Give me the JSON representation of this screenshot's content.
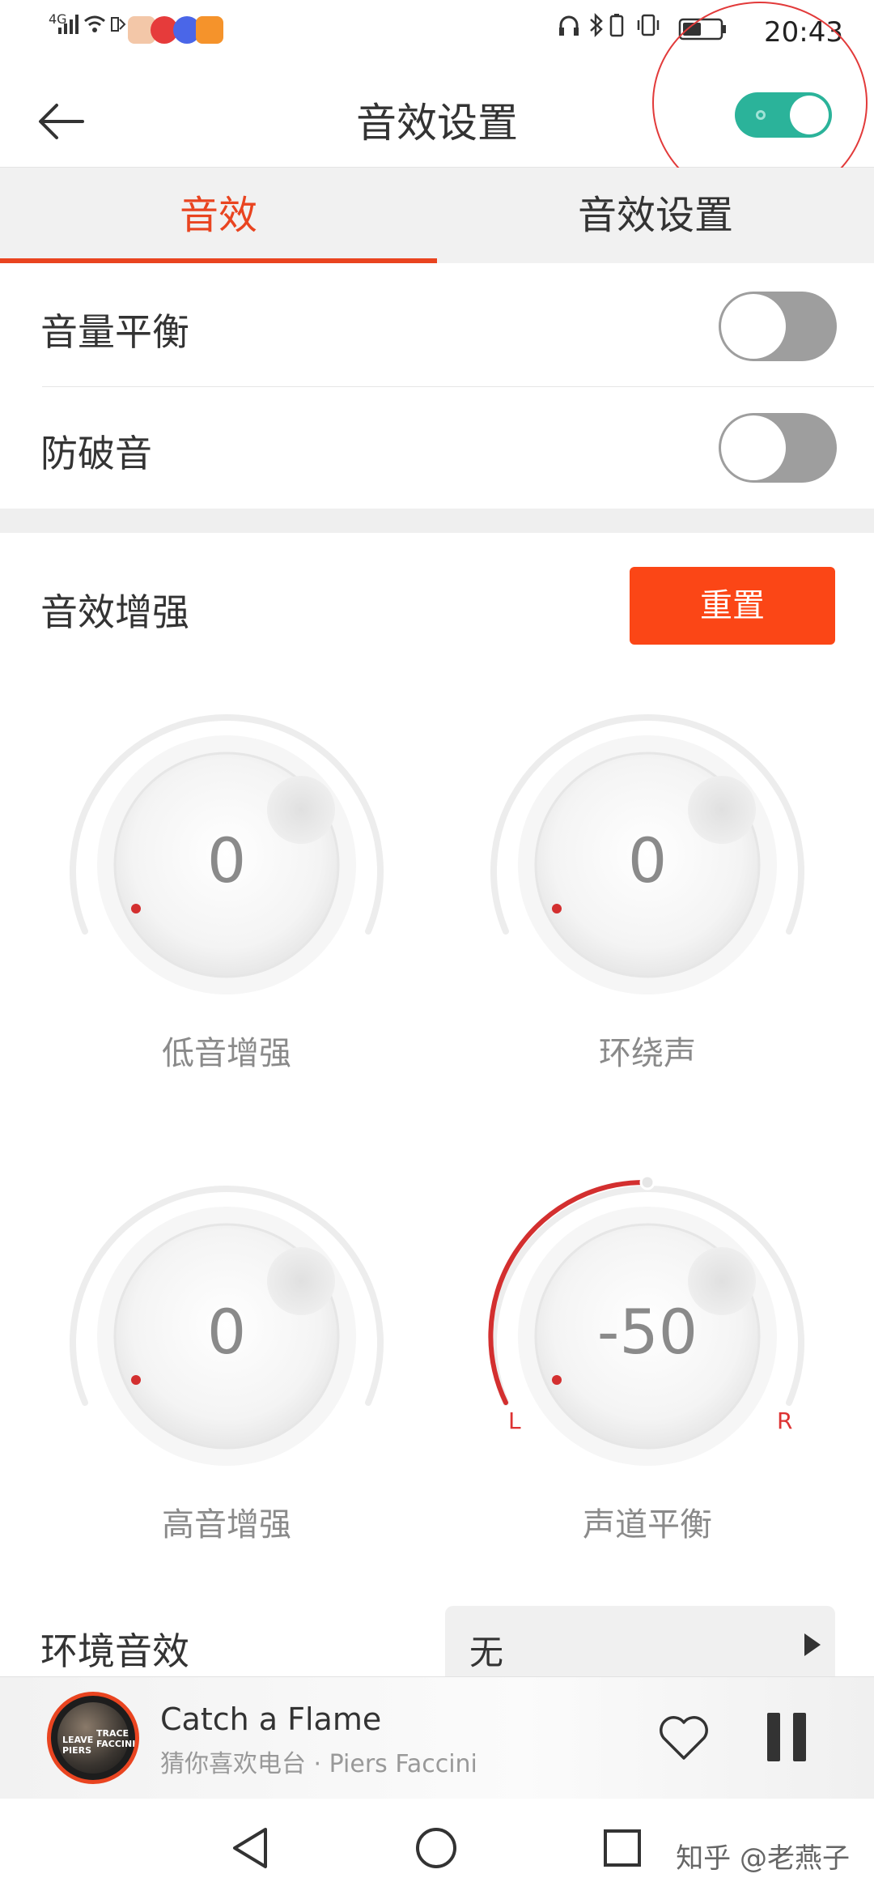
{
  "status_bar": {
    "network": "4G",
    "time": "20:43",
    "app_icons": [
      "news-app-icon",
      "weibo-icon",
      "music-icon",
      "video-icon"
    ]
  },
  "header": {
    "title": "音效设置",
    "master_toggle_on": true
  },
  "tabs": [
    {
      "label": "音效",
      "active": true
    },
    {
      "label": "音效设置",
      "active": false
    }
  ],
  "settings": {
    "volume_balance": {
      "label": "音量平衡",
      "on": false
    },
    "anti_clipping": {
      "label": "防破音",
      "on": false
    }
  },
  "enhancement": {
    "title": "音效增强",
    "reset_label": "重置",
    "knobs": {
      "bass": {
        "label": "低音增强",
        "value": "0"
      },
      "surround": {
        "label": "环绕声",
        "value": "0"
      },
      "treble": {
        "label": "高音增强",
        "value": "0"
      },
      "balance": {
        "label": "声道平衡",
        "value": "-50",
        "left_mark": "L",
        "right_mark": "R"
      }
    }
  },
  "ambience": {
    "label": "环境音效",
    "selected": "无"
  },
  "player": {
    "song_title": "Catch a Flame",
    "subtitle": "猜你喜欢电台 · Piers Faccini",
    "album_text_left": "LEAVE PIERS",
    "album_text_right": "TRACE FACCINI"
  },
  "watermark": "知乎 @老燕子",
  "colors": {
    "accent": "#e94420",
    "reset_button": "#fb4616",
    "toggle_on": "#2bb39a",
    "toggle_off": "#9e9e9e",
    "knob_indicator": "#d32f2f"
  }
}
